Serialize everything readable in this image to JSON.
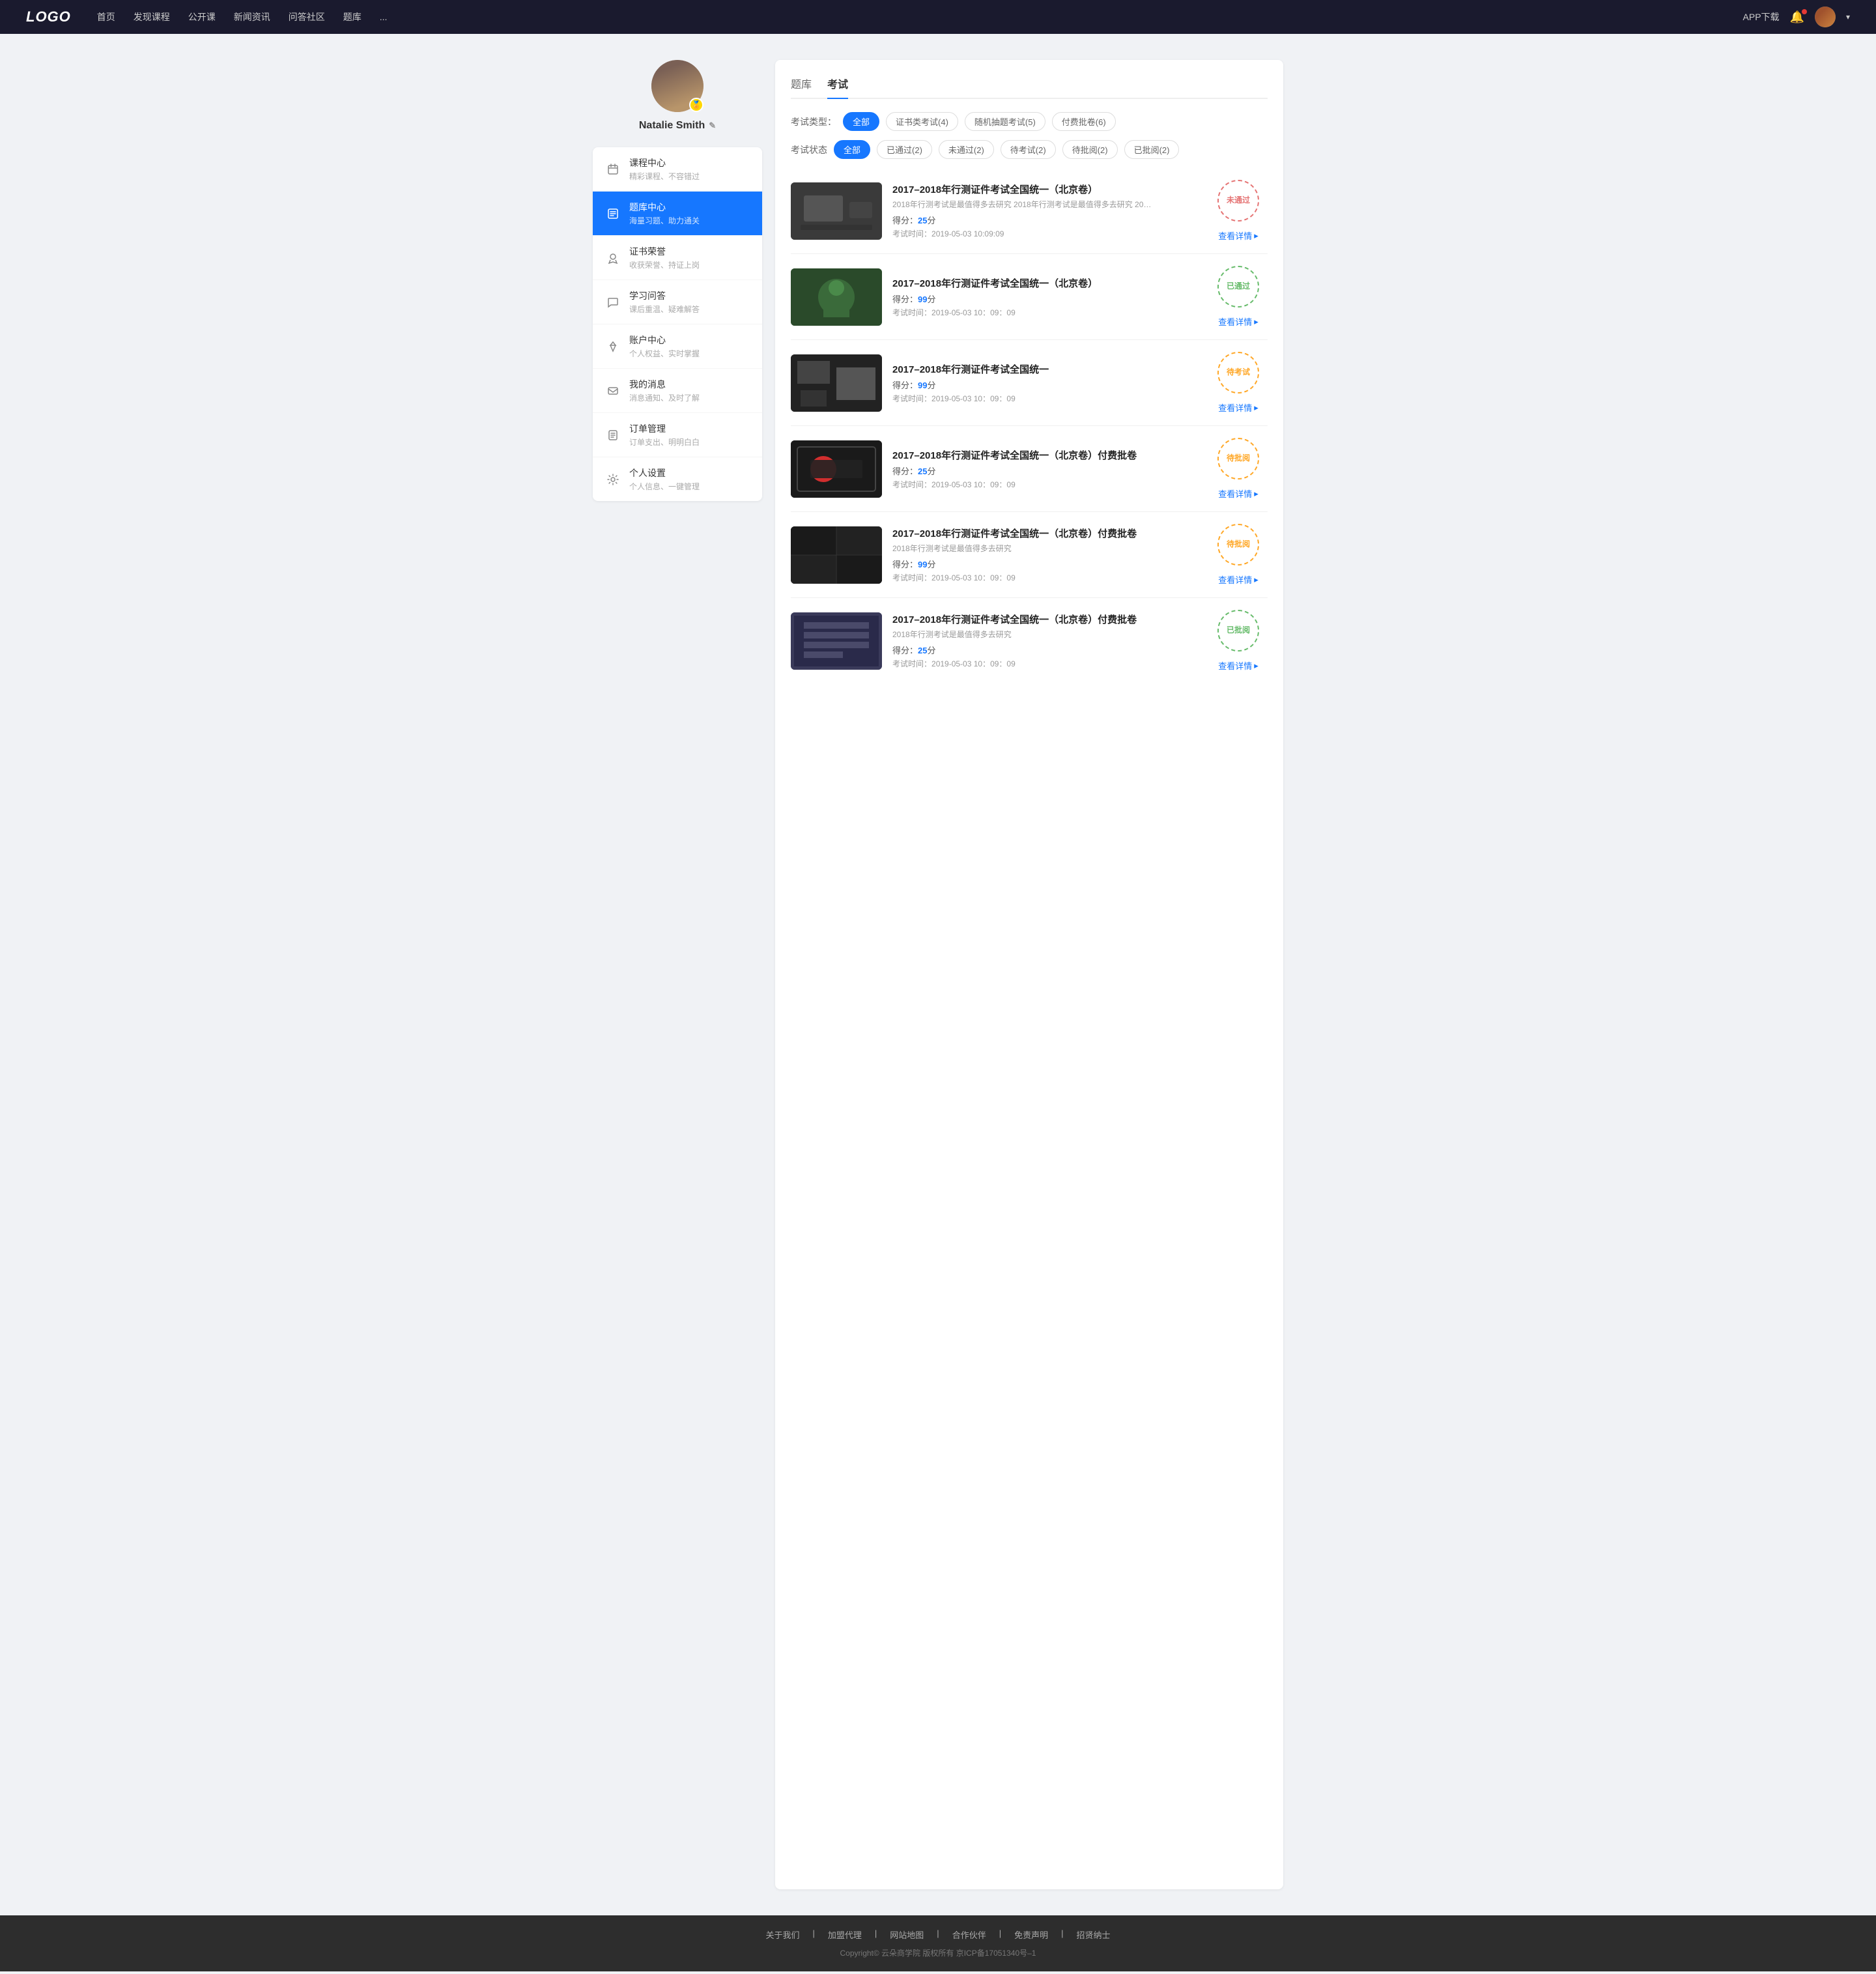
{
  "navbar": {
    "logo": "LOGO",
    "links": [
      "首页",
      "发现课程",
      "公开课",
      "新闻资讯",
      "问答社区",
      "题库",
      "..."
    ],
    "appDownload": "APP下载",
    "user": "Natalie Smith"
  },
  "sidebar": {
    "userName": "Natalie Smith",
    "menu": [
      {
        "id": "course",
        "label": "课程中心",
        "sub": "精彩课程、不容错过",
        "icon": "calendar"
      },
      {
        "id": "question",
        "label": "题库中心",
        "sub": "海量习题、助力通关",
        "icon": "list",
        "active": true
      },
      {
        "id": "cert",
        "label": "证书荣誉",
        "sub": "收获荣誉、持证上岗",
        "icon": "award"
      },
      {
        "id": "qa",
        "label": "学习问答",
        "sub": "课后重温、疑难解答",
        "icon": "chat"
      },
      {
        "id": "account",
        "label": "账户中心",
        "sub": "个人权益、实时掌握",
        "icon": "diamond"
      },
      {
        "id": "message",
        "label": "我的消息",
        "sub": "消息通知、及时了解",
        "icon": "message"
      },
      {
        "id": "order",
        "label": "订单管理",
        "sub": "订单支出、明明白白",
        "icon": "file"
      },
      {
        "id": "settings",
        "label": "个人设置",
        "sub": "个人信息、一键管理",
        "icon": "gear"
      }
    ]
  },
  "mainTabs": [
    "题库",
    "考试"
  ],
  "activeTab": "考试",
  "examTypeLabel": "考试类型：",
  "examTypes": [
    {
      "label": "全部",
      "active": true
    },
    {
      "label": "证书类考试(4)"
    },
    {
      "label": "随机抽题考试(5)"
    },
    {
      "label": "付费批卷(6)"
    }
  ],
  "examStatusLabel": "考试状态",
  "examStatuses": [
    {
      "label": "全部",
      "active": true
    },
    {
      "label": "已通过(2)"
    },
    {
      "label": "未通过(2)"
    },
    {
      "label": "待考试(2)"
    },
    {
      "label": "待批阅(2)"
    },
    {
      "label": "已批阅(2)"
    }
  ],
  "exams": [
    {
      "title": "2017–2018年行测证件考试全国统一（北京卷）",
      "desc": "2018年行测考试是最值得多去研究 2018年行测考试是最值得多去研究 2018年行...",
      "score": "25",
      "time": "2019-05-03  10:09:09",
      "status": "not-passed",
      "statusLabel": "未通过",
      "thumbClass": "thumb-1",
      "detailLabel": "查看详情"
    },
    {
      "title": "2017–2018年行测证件考试全国统一（北京卷）",
      "desc": "",
      "score": "99",
      "time": "2019-05-03  10：09：09",
      "status": "passed",
      "statusLabel": "已通过",
      "thumbClass": "thumb-2",
      "detailLabel": "查看详情"
    },
    {
      "title": "2017–2018年行测证件考试全国统一",
      "desc": "",
      "score": "99",
      "time": "2019-05-03  10：09：09",
      "status": "pending",
      "statusLabel": "待考试",
      "thumbClass": "thumb-3",
      "detailLabel": "查看详情"
    },
    {
      "title": "2017–2018年行测证件考试全国统一（北京卷）付费批卷",
      "desc": "",
      "score": "25",
      "time": "2019-05-03  10：09：09",
      "status": "pending-review",
      "statusLabel": "待批阅",
      "thumbClass": "thumb-4",
      "detailLabel": "查看详情"
    },
    {
      "title": "2017–2018年行测证件考试全国统一（北京卷）付费批卷",
      "desc": "2018年行测考试是最值得多去研究",
      "score": "99",
      "time": "2019-05-03  10：09：09",
      "status": "pending-review",
      "statusLabel": "待批阅",
      "thumbClass": "thumb-5",
      "detailLabel": "查看详情"
    },
    {
      "title": "2017–2018年行测证件考试全国统一（北京卷）付费批卷",
      "desc": "2018年行测考试是最值得多去研究",
      "score": "25",
      "time": "2019-05-03  10：09：09",
      "status": "reviewed",
      "statusLabel": "已批阅",
      "thumbClass": "thumb-6",
      "detailLabel": "查看详情"
    }
  ],
  "footer": {
    "links": [
      "关于我们",
      "加盟代理",
      "网站地图",
      "合作伙伴",
      "免责声明",
      "招贤纳士"
    ],
    "copyright": "Copyright© 云朵商学院  版权所有    京ICP备17051340号–1"
  }
}
